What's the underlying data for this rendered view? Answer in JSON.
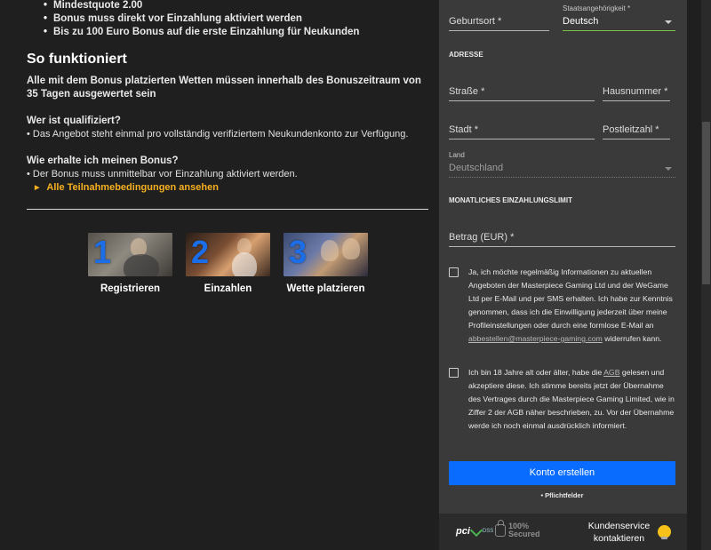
{
  "intro": {
    "bullets": [
      "Mindestquote 2.00",
      "Bonus muss direkt vor Einzahlung aktiviert werden",
      "Bis zu 100 Euro Bonus auf die erste Einzahlung für Neukunden"
    ]
  },
  "how_it_works": {
    "title": "So funktioniert",
    "rules": "Alle mit dem Bonus platzierten Wetten müssen innerhalb des Bonuszeitraum von 35 Tagen ausgewertet sein",
    "q1": "Wer ist qualifiziert?",
    "a1": "• Das Angebot steht einmal pro vollständig verifiziertem Neukundenkonto zur Verfügung.",
    "q2": "Wie erhalte ich meinen Bonus?",
    "a2": "• Der Bonus muss unmittelbar vor Einzahlung aktiviert werden.",
    "terms_link": "Alle Teilnahmebedingungen ansehen"
  },
  "steps": [
    {
      "number": "1",
      "caption": "Registrieren"
    },
    {
      "number": "2",
      "caption": "Einzahlen"
    },
    {
      "number": "3",
      "caption": "Wette platzieren"
    }
  ],
  "form": {
    "birthplace_label": "Geburtsort *",
    "nationality_label": "Staatsangehörigkeit *",
    "nationality_value": "Deutsch",
    "address_heading": "ADRESSE",
    "street_label": "Straße *",
    "house_number_label": "Hausnummer *",
    "city_label": "Stadt *",
    "zip_label": "Postleitzahl *",
    "country_label": "Land",
    "country_value": "Deutschland",
    "limit_heading": "MONATLICHES EINZAHLUNGSLIMIT",
    "amount_label": "Betrag (EUR) *",
    "consent1_a": "Ja, ich möchte regelmäßig Informationen zu aktuellen Angeboten der Masterpiece Gaming Ltd und der WeGame Ltd per E-Mail und per SMS erhalten. Ich habe zur Kenntnis genommen, dass ich die Einwilligung jederzeit über meine Profileinstellungen oder durch eine formlose E-Mail an ",
    "consent1_email": "abbestellen@masterpiece-gaming.com",
    "consent1_b": " widerrufen kann.",
    "consent2_a": "Ich bin 18 Jahre alt oder älter, habe die ",
    "consent2_agb": "AGB",
    "consent2_b": " gelesen und akzeptiere diese. Ich stimme bereits jetzt der Übernahme des Vertrages durch die Masterpiece Gaming Limited, wie in Ziffer 2 der AGB näher beschrieben, zu. Vor der Übernahme werde ich noch einmal ausdrücklich informiert.",
    "submit_label": "Konto erstellen",
    "required_note": "• Pflichtfelder"
  },
  "footer": {
    "pci_text": "pci",
    "pci_dss": "DSS",
    "secured_top": "100%",
    "secured_bottom": "Secured",
    "support_line1": "Kundenservice",
    "support_line2": "kontaktieren"
  },
  "colors": {
    "accent_blue": "#0a6cff",
    "link_orange": "#f6b021",
    "valid_green": "#7bc143"
  }
}
